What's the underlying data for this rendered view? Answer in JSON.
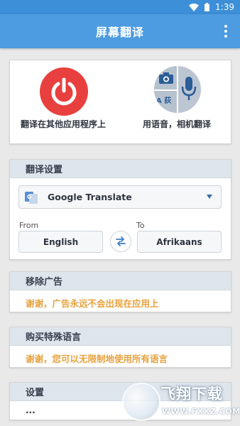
{
  "status_bar": {
    "time": "1:39",
    "icons": [
      "wifi-icon",
      "battery-icon"
    ]
  },
  "app_bar": {
    "title": "屏幕翻译",
    "menu_icon": "more-vert-icon"
  },
  "actions": {
    "translate_in_apps": {
      "label": "翻译在其他应用程序上",
      "icon": "power-icon",
      "color": "#e8403e"
    },
    "voice_camera": {
      "label": "用语音，相机翻译",
      "icons": [
        "camera-icon",
        "text-translate-icon",
        "microphone-icon"
      ],
      "text_glyph": "A 荻"
    }
  },
  "translation_settings": {
    "header": "翻译设置",
    "engine": {
      "name": "Google Translate",
      "icon": "google-translate-icon"
    },
    "from": {
      "label": "From",
      "value": "English"
    },
    "to": {
      "label": "To",
      "value": "Afrikaans"
    },
    "swap_icon": "swap-icon"
  },
  "remove_ads": {
    "header": "移除广告",
    "text": "谢谢，广告永远不会出现在应用上"
  },
  "buy_languages": {
    "header": "购买特殊语言",
    "text": "谢谢，您可以无限制地使用所有语言"
  },
  "settings": {
    "header": "设置",
    "text": "..."
  },
  "watermark": {
    "title": "飞翔下载",
    "url": "WWW.FXXZ.COM"
  },
  "colors": {
    "primary": "#4d9be0",
    "accent": "#e8a03a",
    "power_red": "#e8403e"
  }
}
